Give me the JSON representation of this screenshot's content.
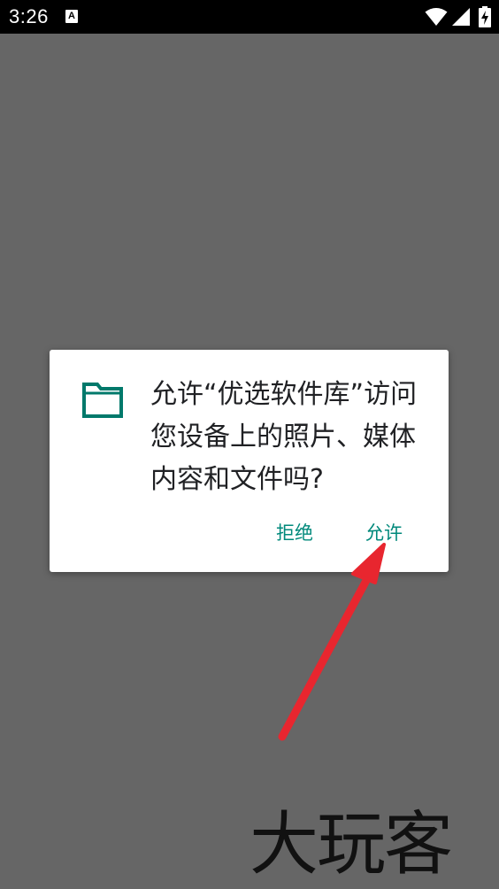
{
  "status_bar": {
    "time": "3:26",
    "notification_letter": "A",
    "icons": [
      "wifi-icon",
      "signal-icon",
      "battery-charging-icon"
    ]
  },
  "dialog": {
    "icon": "folder-icon",
    "message": "允许“优选软件库”访问您设备上的照片、媒体内容和文件吗?",
    "deny_label": "拒绝",
    "allow_label": "允许"
  },
  "annotation": {
    "arrow_color": "#e8262f",
    "points_to": "allow-button"
  },
  "watermark": {
    "text": "大玩客"
  },
  "colors": {
    "overlay_background": "#666666",
    "status_bar": "#000000",
    "accent": "#00897b",
    "folder_icon": "#00796b",
    "dialog_background": "#ffffff"
  }
}
